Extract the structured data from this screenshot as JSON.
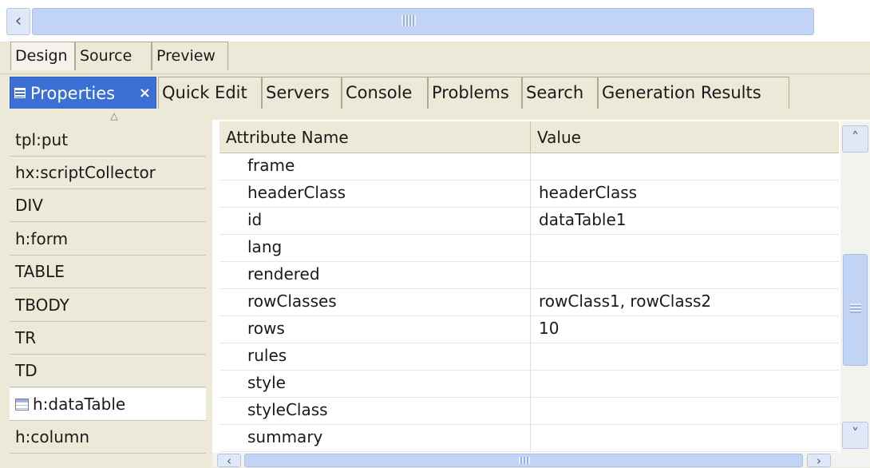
{
  "top_scrollbar": {
    "left_arrow_icon": "chevron-left-icon"
  },
  "editor_tabs": [
    {
      "label": "Design"
    },
    {
      "label": "Source"
    },
    {
      "label": "Preview"
    }
  ],
  "view_tabs": {
    "properties": {
      "label": "Properties",
      "icon": "properties-view-icon",
      "close_glyph": "×"
    },
    "others": [
      {
        "label": "Quick Edit"
      },
      {
        "label": "Servers"
      },
      {
        "label": "Console"
      },
      {
        "label": "Problems"
      },
      {
        "label": "Search"
      },
      {
        "label": "Generation Results"
      }
    ]
  },
  "hierarchy": {
    "items": [
      {
        "label": "tpl:put"
      },
      {
        "label": "hx:scriptCollector"
      },
      {
        "label": "DIV"
      },
      {
        "label": "h:form"
      },
      {
        "label": "TABLE"
      },
      {
        "label": "TBODY"
      },
      {
        "label": "TR"
      },
      {
        "label": "TD"
      },
      {
        "label": "h:dataTable",
        "selected": true,
        "icon": "table-icon"
      },
      {
        "label": "h:column"
      }
    ]
  },
  "attributes": {
    "columns": [
      "Attribute Name",
      "Value"
    ],
    "rows": [
      {
        "name": "frame",
        "value": ""
      },
      {
        "name": "headerClass",
        "value": "headerClass"
      },
      {
        "name": "id",
        "value": "dataTable1"
      },
      {
        "name": "lang",
        "value": ""
      },
      {
        "name": "rendered",
        "value": ""
      },
      {
        "name": "rowClasses",
        "value": "rowClass1, rowClass2"
      },
      {
        "name": "rows",
        "value": "10"
      },
      {
        "name": "rules",
        "value": ""
      },
      {
        "name": "style",
        "value": ""
      },
      {
        "name": "styleClass",
        "value": ""
      },
      {
        "name": "summary",
        "value": ""
      }
    ]
  },
  "colors": {
    "active_tab": "#3b6fd3",
    "panel_bg": "#ece9d8",
    "scroll_thumb": "#c2d4f5"
  }
}
